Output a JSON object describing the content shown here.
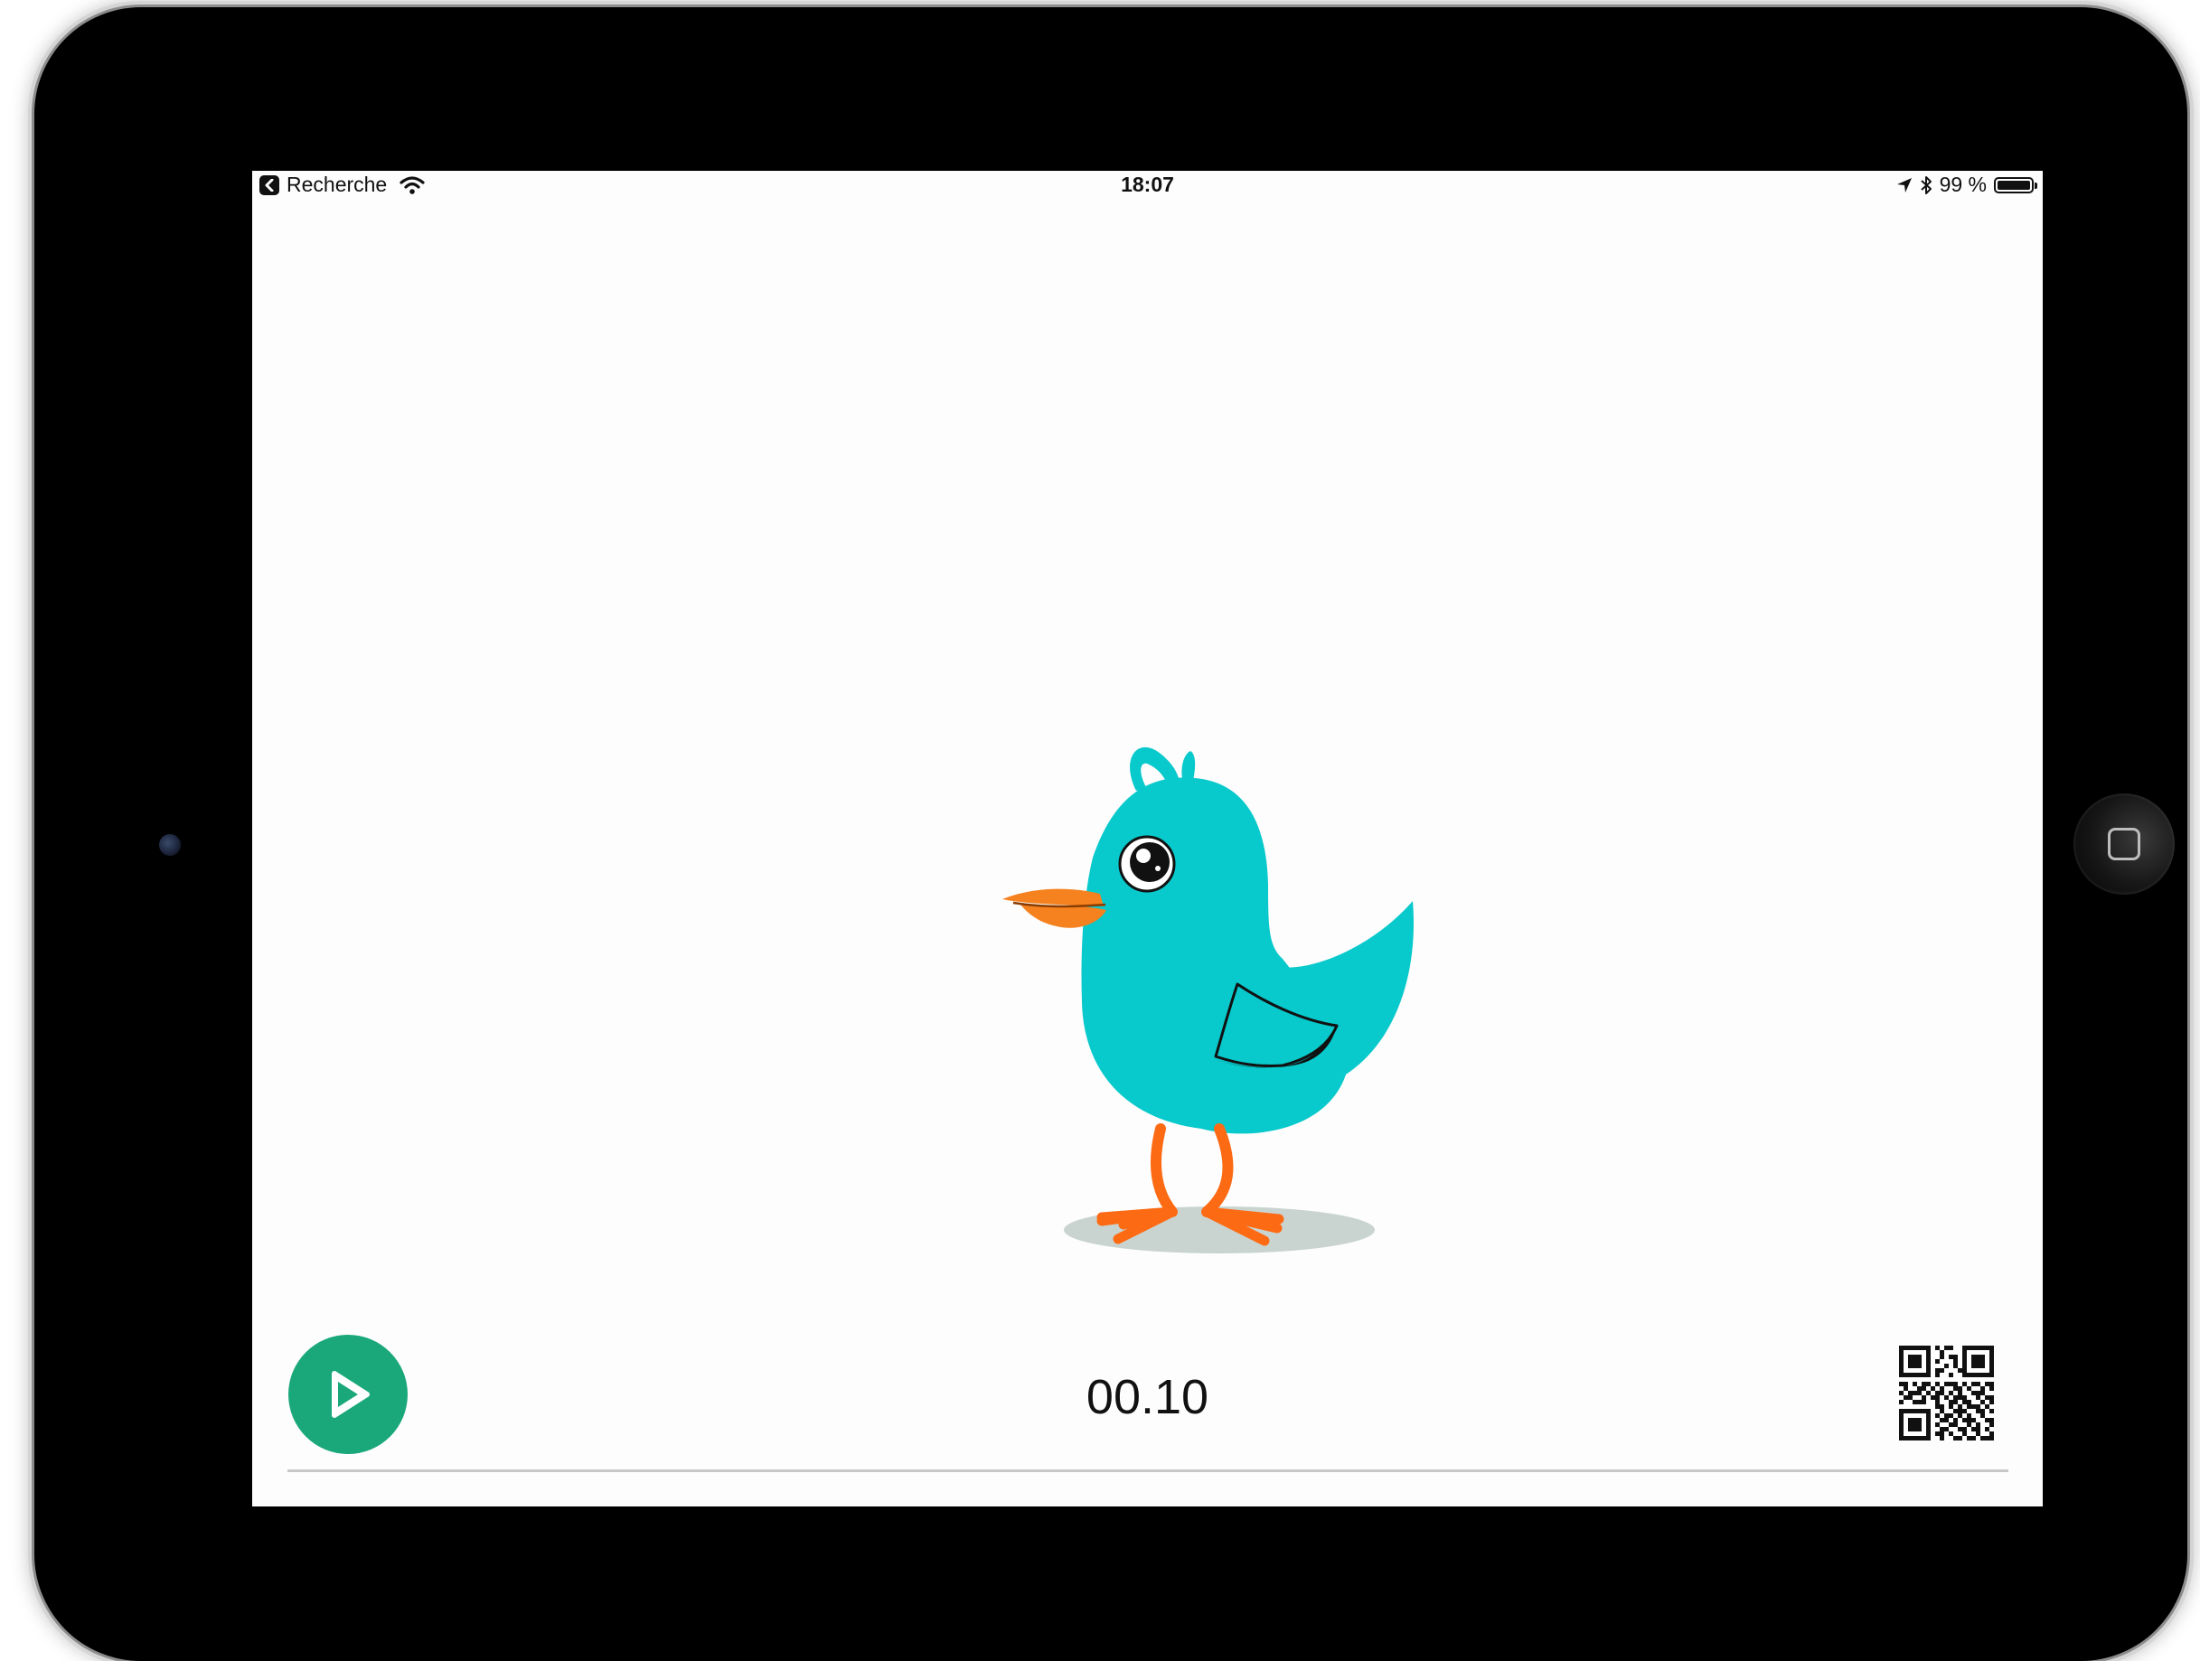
{
  "status_bar": {
    "back_label": "Recherche",
    "time": "18:07",
    "battery": "99 %",
    "battery_level": 0.99,
    "icons": [
      "back-chevron-icon",
      "wifi-icon",
      "location-arrow-icon",
      "bluetooth-icon",
      "battery-icon"
    ]
  },
  "player": {
    "timer": "00.10",
    "play_icon": "play-icon",
    "qr_icon": "qr-code-icon",
    "progress": 0.0,
    "accent_color": "#1aa87a"
  },
  "illustration": {
    "subject": "bird-illustration",
    "body_color": "#08c9cc",
    "beak_color": "#f5811f",
    "leg_color": "#fd6a14"
  }
}
